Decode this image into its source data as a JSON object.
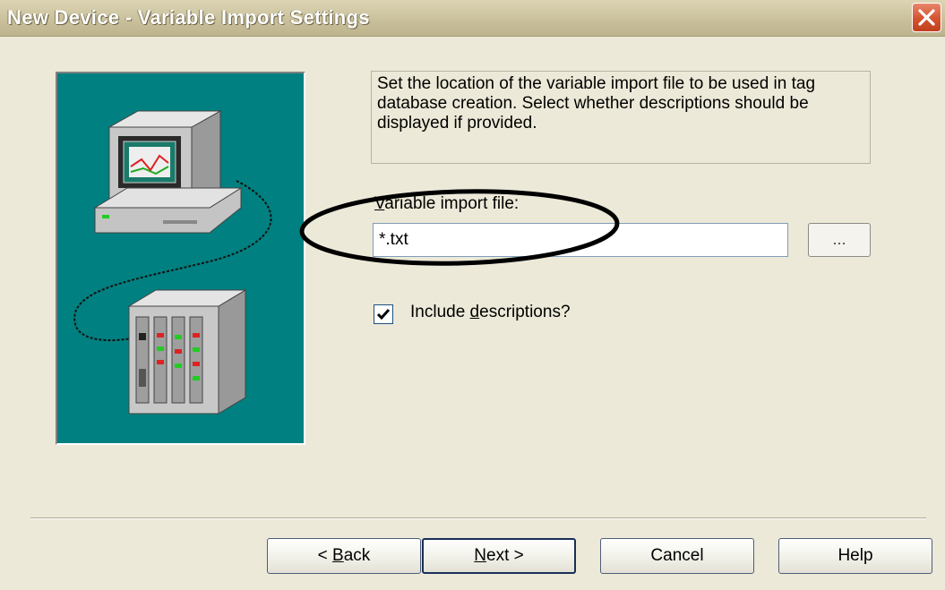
{
  "window": {
    "title": "New Device - Variable Import Settings"
  },
  "description": "Set the location of the variable import file to be used in tag database creation.  Select whether descriptions should be displayed if provided.",
  "import_file": {
    "label_mnemonic": "V",
    "label_rest": "ariable import file:",
    "value": "*.txt",
    "browse_label": "..."
  },
  "include_descriptions": {
    "checked": true,
    "label_pre": "Include ",
    "label_mnemonic": "d",
    "label_post": "escriptions?"
  },
  "buttons": {
    "back_pre": "< ",
    "back_mnemonic": "B",
    "back_post": "ack",
    "next_mnemonic": "N",
    "next_post": "ext >",
    "cancel": "Cancel",
    "help": "Help"
  },
  "icons": [
    "close-icon",
    "computer-icon",
    "controller-rack-icon",
    "checkmark-icon"
  ],
  "colors": {
    "dialog_bg": "#ece9d8",
    "illustration_bg": "#008080",
    "close_button": "#d3532f",
    "annotation_ellipse": "#000000"
  }
}
